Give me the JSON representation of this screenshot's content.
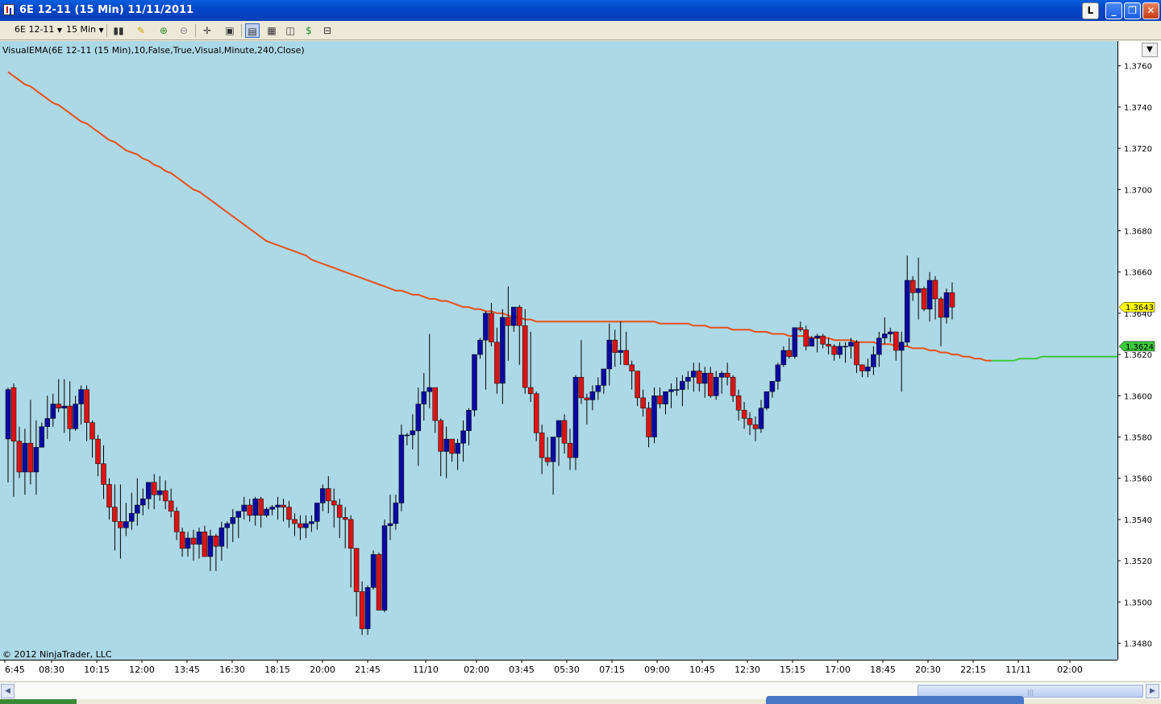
{
  "window": {
    "title": "6E 12-11 (15 Min)  11/11/2011",
    "link_button": "L",
    "min_button": "_",
    "max_button": "❐",
    "close_button": "✕"
  },
  "toolbar": {
    "instrument": "6E 12-11",
    "interval": "15 Min",
    "icons": [
      "bar-type-icon",
      "draw-tool-icon",
      "zoom-in-icon",
      "zoom-out-icon",
      "crosshair-icon",
      "properties-icon",
      "data-box-icon",
      "indicators-icon",
      "strategies-icon",
      "orders-icon",
      "tab-icon"
    ]
  },
  "indicator_label": "VisualEMA(6E 12-11 (15 Min),10,False,True,Visual,Minute,240,Close)",
  "copyright": "© 2012 NinjaTrader, LLC",
  "colors": {
    "background": "#add8e6",
    "up_candle": "#0a0aa0",
    "down_candle": "#dc1414",
    "ema_down": "#e8501a",
    "ema_up": "#3cc83c",
    "current_price_label": "#ffff00",
    "ema_price_label": "#3cc83c"
  },
  "chart_data": {
    "type": "candlestick",
    "title": "6E 12-11 (15 Min)",
    "ylim": [
      1.3472,
      1.3772
    ],
    "y_ticks": [
      "1.3760",
      "1.3740",
      "1.3720",
      "1.3700",
      "1.3680",
      "1.3660",
      "1.3640",
      "1.3620",
      "1.3600",
      "1.3580",
      "1.3560",
      "1.3540",
      "1.3520",
      "1.3500",
      "1.3480"
    ],
    "x_ticks": [
      "6:45",
      "08:30",
      "10:15",
      "12:00",
      "13:45",
      "16:30",
      "18:15",
      "20:00",
      "21:45",
      "11/10",
      "02:00",
      "03:45",
      "05:30",
      "07:15",
      "09:00",
      "10:45",
      "12:30",
      "15:15",
      "17:00",
      "18:45",
      "20:30",
      "22:15",
      "11/11",
      "02:00"
    ],
    "current_price": "1.3643",
    "ema_value": "1.3624",
    "candles_ohlc": [
      [
        1.3579,
        1.3604,
        1.3558,
        1.3603
      ],
      [
        1.3604,
        1.3606,
        1.3551,
        1.3578
      ],
      [
        1.3578,
        1.3585,
        1.356,
        1.3563
      ],
      [
        1.3563,
        1.3584,
        1.3552,
        1.3577
      ],
      [
        1.3577,
        1.3598,
        1.3557,
        1.3563
      ],
      [
        1.3563,
        1.3588,
        1.3552,
        1.3575
      ],
      [
        1.3575,
        1.3587,
        1.3576,
        1.3585
      ],
      [
        1.3585,
        1.36,
        1.3579,
        1.3589
      ],
      [
        1.3589,
        1.3601,
        1.3585,
        1.3596
      ],
      [
        1.3596,
        1.3608,
        1.3592,
        1.3594
      ],
      [
        1.3594,
        1.3608,
        1.3582,
        1.3595
      ],
      [
        1.3595,
        1.3607,
        1.3578,
        1.3584
      ],
      [
        1.3584,
        1.36,
        1.3583,
        1.3596
      ],
      [
        1.3596,
        1.3605,
        1.3586,
        1.3603
      ],
      [
        1.3603,
        1.3605,
        1.3578,
        1.3587
      ],
      [
        1.3587,
        1.3588,
        1.357,
        1.3579
      ],
      [
        1.3579,
        1.3581,
        1.3561,
        1.3567
      ],
      [
        1.3567,
        1.3576,
        1.355,
        1.3557
      ],
      [
        1.3557,
        1.356,
        1.354,
        1.3546
      ],
      [
        1.3546,
        1.3557,
        1.3525,
        1.3539
      ],
      [
        1.3539,
        1.3557,
        1.3521,
        1.3536
      ],
      [
        1.3536,
        1.3548,
        1.3532,
        1.3539
      ],
      [
        1.3539,
        1.3553,
        1.3535,
        1.3543
      ],
      [
        1.3543,
        1.356,
        1.3537,
        1.3547
      ],
      [
        1.3547,
        1.3555,
        1.3542,
        1.355
      ],
      [
        1.355,
        1.3558,
        1.3545,
        1.3558
      ],
      [
        1.3558,
        1.3562,
        1.3545,
        1.3552
      ],
      [
        1.3552,
        1.3561,
        1.3549,
        1.3554
      ],
      [
        1.3554,
        1.3559,
        1.3545,
        1.3549
      ],
      [
        1.3549,
        1.3555,
        1.3541,
        1.3544
      ],
      [
        1.3544,
        1.3546,
        1.353,
        1.3534
      ],
      [
        1.3534,
        1.3536,
        1.3522,
        1.3526
      ],
      [
        1.3526,
        1.3534,
        1.3522,
        1.3531
      ],
      [
        1.3531,
        1.3535,
        1.352,
        1.3528
      ],
      [
        1.3528,
        1.3536,
        1.3521,
        1.3534
      ],
      [
        1.3534,
        1.3537,
        1.3524,
        1.3522
      ],
      [
        1.3522,
        1.3535,
        1.3515,
        1.3532
      ],
      [
        1.3532,
        1.3533,
        1.3515,
        1.3527
      ],
      [
        1.3527,
        1.3539,
        1.352,
        1.3536
      ],
      [
        1.3536,
        1.3539,
        1.3526,
        1.3538
      ],
      [
        1.3538,
        1.3545,
        1.3529,
        1.3541
      ],
      [
        1.3541,
        1.3544,
        1.3531,
        1.3544
      ],
      [
        1.3544,
        1.3551,
        1.354,
        1.3547
      ],
      [
        1.3547,
        1.355,
        1.3539,
        1.3542
      ],
      [
        1.3542,
        1.3551,
        1.3537,
        1.355
      ],
      [
        1.355,
        1.3551,
        1.3536,
        1.3542
      ],
      [
        1.3542,
        1.3546,
        1.3541,
        1.3545
      ],
      [
        1.3545,
        1.3547,
        1.3542,
        1.3546
      ],
      [
        1.3546,
        1.3551,
        1.354,
        1.3547
      ],
      [
        1.3547,
        1.355,
        1.3539,
        1.3546
      ],
      [
        1.3546,
        1.3549,
        1.3536,
        1.354
      ],
      [
        1.354,
        1.3543,
        1.3532,
        1.3538
      ],
      [
        1.3538,
        1.3542,
        1.353,
        1.3536
      ],
      [
        1.3536,
        1.3542,
        1.3531,
        1.3538
      ],
      [
        1.3538,
        1.3542,
        1.3534,
        1.3539
      ],
      [
        1.3539,
        1.3547,
        1.3535,
        1.3548
      ],
      [
        1.3548,
        1.3557,
        1.3544,
        1.3555
      ],
      [
        1.3555,
        1.3561,
        1.3543,
        1.3549
      ],
      [
        1.3549,
        1.3555,
        1.3536,
        1.3547
      ],
      [
        1.3547,
        1.355,
        1.3531,
        1.3541
      ],
      [
        1.3541,
        1.3546,
        1.3526,
        1.354
      ],
      [
        1.354,
        1.3542,
        1.3507,
        1.3526
      ],
      [
        1.3526,
        1.3526,
        1.3493,
        1.3505
      ],
      [
        1.3505,
        1.351,
        1.3484,
        1.3487
      ],
      [
        1.3487,
        1.3508,
        1.3484,
        1.3507
      ],
      [
        1.3507,
        1.3525,
        1.3506,
        1.3523
      ],
      [
        1.3523,
        1.3524,
        1.3496,
        1.3496
      ],
      [
        1.3496,
        1.354,
        1.3495,
        1.3537
      ],
      [
        1.3537,
        1.3552,
        1.353,
        1.3538
      ],
      [
        1.3538,
        1.3552,
        1.3535,
        1.3548
      ],
      [
        1.3548,
        1.3586,
        1.3544,
        1.3581
      ],
      [
        1.3581,
        1.3582,
        1.3576,
        1.3581
      ],
      [
        1.3581,
        1.3591,
        1.3574,
        1.3583
      ],
      [
        1.3583,
        1.3604,
        1.3566,
        1.3596
      ],
      [
        1.3596,
        1.3611,
        1.3588,
        1.3602
      ],
      [
        1.3602,
        1.363,
        1.3594,
        1.3604
      ],
      [
        1.3604,
        1.3603,
        1.3582,
        1.3588
      ],
      [
        1.3588,
        1.3589,
        1.3561,
        1.3573
      ],
      [
        1.3573,
        1.3585,
        1.356,
        1.3579
      ],
      [
        1.3579,
        1.3579,
        1.3568,
        1.3572
      ],
      [
        1.3572,
        1.3579,
        1.3564,
        1.3577
      ],
      [
        1.3577,
        1.3588,
        1.3568,
        1.3583
      ],
      [
        1.3583,
        1.3594,
        1.3576,
        1.3593
      ],
      [
        1.3593,
        1.3614,
        1.359,
        1.362
      ],
      [
        1.362,
        1.3628,
        1.3618,
        1.3627
      ],
      [
        1.3627,
        1.3641,
        1.3603,
        1.364
      ],
      [
        1.364,
        1.3645,
        1.3624,
        1.3626
      ],
      [
        1.3626,
        1.3633,
        1.3601,
        1.3606
      ],
      [
        1.3606,
        1.3642,
        1.3596,
        1.3638
      ],
      [
        1.3638,
        1.3653,
        1.3617,
        1.3634
      ],
      [
        1.3634,
        1.3643,
        1.3631,
        1.3643
      ],
      [
        1.3643,
        1.3644,
        1.3615,
        1.3634
      ],
      [
        1.3634,
        1.3642,
        1.3601,
        1.3604
      ],
      [
        1.3604,
        1.3631,
        1.3597,
        1.3601
      ],
      [
        1.3601,
        1.3602,
        1.3578,
        1.3582
      ],
      [
        1.3582,
        1.3586,
        1.3562,
        1.357
      ],
      [
        1.357,
        1.358,
        1.3566,
        1.3568
      ],
      [
        1.3568,
        1.3578,
        1.3552,
        1.358
      ],
      [
        1.358,
        1.3588,
        1.3566,
        1.3588
      ],
      [
        1.3588,
        1.3591,
        1.3572,
        1.3577
      ],
      [
        1.3577,
        1.3584,
        1.3564,
        1.357
      ],
      [
        1.357,
        1.361,
        1.3564,
        1.3609
      ],
      [
        1.3609,
        1.3627,
        1.3596,
        1.3599
      ],
      [
        1.3599,
        1.3601,
        1.3586,
        1.3598
      ],
      [
        1.3598,
        1.3605,
        1.3593,
        1.3602
      ],
      [
        1.3602,
        1.3609,
        1.3598,
        1.3605
      ],
      [
        1.3605,
        1.3613,
        1.3601,
        1.3613
      ],
      [
        1.3613,
        1.3635,
        1.3605,
        1.3627
      ],
      [
        1.3627,
        1.3632,
        1.3614,
        1.3621
      ],
      [
        1.3621,
        1.3636,
        1.3615,
        1.3622
      ],
      [
        1.3622,
        1.3631,
        1.3615,
        1.3615
      ],
      [
        1.3615,
        1.3617,
        1.3603,
        1.3612
      ],
      [
        1.3612,
        1.3612,
        1.3595,
        1.3599
      ],
      [
        1.3599,
        1.3603,
        1.359,
        1.3594
      ],
      [
        1.3594,
        1.3597,
        1.3575,
        1.358
      ],
      [
        1.358,
        1.3604,
        1.3577,
        1.36
      ],
      [
        1.36,
        1.3604,
        1.3594,
        1.3596
      ],
      [
        1.3596,
        1.3601,
        1.3591,
        1.3602
      ],
      [
        1.3602,
        1.3606,
        1.3594,
        1.3603
      ],
      [
        1.3603,
        1.3609,
        1.36,
        1.3603
      ],
      [
        1.3603,
        1.361,
        1.3595,
        1.3607
      ],
      [
        1.3607,
        1.3612,
        1.3603,
        1.3609
      ],
      [
        1.3609,
        1.3616,
        1.3602,
        1.3612
      ],
      [
        1.3612,
        1.3616,
        1.3602,
        1.3606
      ],
      [
        1.3606,
        1.3614,
        1.3599,
        1.3611
      ],
      [
        1.3611,
        1.3614,
        1.3599,
        1.36
      ],
      [
        1.36,
        1.3612,
        1.3598,
        1.3609
      ],
      [
        1.3609,
        1.3612,
        1.3601,
        1.3611
      ],
      [
        1.3611,
        1.3616,
        1.3605,
        1.3609
      ],
      [
        1.3609,
        1.361,
        1.3597,
        1.36
      ],
      [
        1.36,
        1.3603,
        1.3588,
        1.3593
      ],
      [
        1.3593,
        1.3597,
        1.3584,
        1.3589
      ],
      [
        1.3589,
        1.3592,
        1.3581,
        1.3586
      ],
      [
        1.3586,
        1.359,
        1.3578,
        1.3584
      ],
      [
        1.3584,
        1.3598,
        1.3582,
        1.3594
      ],
      [
        1.3594,
        1.3601,
        1.3593,
        1.3602
      ],
      [
        1.3602,
        1.3607,
        1.3599,
        1.3607
      ],
      [
        1.3607,
        1.3616,
        1.3603,
        1.3615
      ],
      [
        1.3615,
        1.3624,
        1.3614,
        1.3622
      ],
      [
        1.3622,
        1.3628,
        1.3618,
        1.3619
      ],
      [
        1.3619,
        1.3633,
        1.3618,
        1.3633
      ],
      [
        1.3633,
        1.3636,
        1.3631,
        1.3632
      ],
      [
        1.3632,
        1.3634,
        1.3622,
        1.3624
      ],
      [
        1.3624,
        1.3629,
        1.3624,
        1.3628
      ],
      [
        1.3628,
        1.363,
        1.3621,
        1.3629
      ],
      [
        1.3629,
        1.363,
        1.3623,
        1.3625
      ],
      [
        1.3625,
        1.3628,
        1.362,
        1.3624
      ],
      [
        1.3624,
        1.3625,
        1.3617,
        1.362
      ],
      [
        1.362,
        1.3626,
        1.3618,
        1.3624
      ],
      [
        1.3624,
        1.3626,
        1.3616,
        1.3624
      ],
      [
        1.3624,
        1.3628,
        1.3618,
        1.3626
      ],
      [
        1.3626,
        1.3627,
        1.3611,
        1.3615
      ],
      [
        1.3615,
        1.3615,
        1.3609,
        1.3612
      ],
      [
        1.3612,
        1.3618,
        1.3609,
        1.3614
      ],
      [
        1.3614,
        1.3624,
        1.361,
        1.362
      ],
      [
        1.362,
        1.3631,
        1.3614,
        1.3628
      ],
      [
        1.3628,
        1.3638,
        1.3625,
        1.363
      ],
      [
        1.363,
        1.3633,
        1.3626,
        1.3631
      ],
      [
        1.3631,
        1.363,
        1.3617,
        1.3622
      ],
      [
        1.3622,
        1.3631,
        1.3602,
        1.3626
      ],
      [
        1.3626,
        1.3668,
        1.3624,
        1.3656
      ],
      [
        1.3656,
        1.3658,
        1.3646,
        1.365
      ],
      [
        1.365,
        1.3667,
        1.3637,
        1.3652
      ],
      [
        1.3652,
        1.3653,
        1.3641,
        1.3642
      ],
      [
        1.3642,
        1.366,
        1.3636,
        1.3656
      ],
      [
        1.3656,
        1.3658,
        1.3637,
        1.3647
      ],
      [
        1.3647,
        1.3648,
        1.3624,
        1.3638
      ],
      [
        1.3638,
        1.3652,
        1.3635,
        1.365
      ],
      [
        1.365,
        1.3655,
        1.3637,
        1.3643
      ]
    ],
    "ema": [
      1.3757,
      1.3755,
      1.3753,
      1.3751,
      1.375,
      1.3748,
      1.3746,
      1.3744,
      1.3742,
      1.3741,
      1.3739,
      1.3737,
      1.3735,
      1.3733,
      1.3732,
      1.373,
      1.3728,
      1.3726,
      1.3724,
      1.3723,
      1.3721,
      1.3719,
      1.3718,
      1.3717,
      1.3715,
      1.3714,
      1.3712,
      1.3711,
      1.3709,
      1.3708,
      1.3706,
      1.3704,
      1.3702,
      1.37,
      1.3699,
      1.3697,
      1.3695,
      1.3693,
      1.3691,
      1.3689,
      1.3687,
      1.3685,
      1.3683,
      1.3681,
      1.3679,
      1.3677,
      1.3675,
      1.3674,
      1.3673,
      1.3672,
      1.3671,
      1.367,
      1.3669,
      1.3668,
      1.3666,
      1.3665,
      1.3664,
      1.3663,
      1.3662,
      1.3661,
      1.366,
      1.3659,
      1.3658,
      1.3657,
      1.3656,
      1.3655,
      1.3654,
      1.3653,
      1.3652,
      1.3651,
      1.3651,
      1.365,
      1.3649,
      1.3649,
      1.3648,
      1.3647,
      1.3647,
      1.3646,
      1.3646,
      1.3645,
      1.3644,
      1.3643,
      1.3643,
      1.3642,
      1.3642,
      1.3641,
      1.3641,
      1.364,
      1.364,
      1.3639,
      1.3638,
      1.3638,
      1.3637,
      1.3637,
      1.3636,
      1.3636,
      1.3636,
      1.3636,
      1.3636,
      1.3636,
      1.3636,
      1.3636,
      1.3636,
      1.3636,
      1.3636,
      1.3636,
      1.3636,
      1.3636,
      1.3636,
      1.3636,
      1.3636,
      1.3636,
      1.3636,
      1.3636,
      1.3636,
      1.3636,
      1.3635,
      1.3635,
      1.3635,
      1.3635,
      1.3635,
      1.3635,
      1.3634,
      1.3634,
      1.3634,
      1.3633,
      1.3633,
      1.3633,
      1.3633,
      1.3632,
      1.3632,
      1.3632,
      1.3632,
      1.3631,
      1.3631,
      1.3631,
      1.363,
      1.363,
      1.363,
      1.3629,
      1.3629,
      1.3629,
      1.3629,
      1.3628,
      1.3628,
      1.3628,
      1.3628,
      1.3627,
      1.3627,
      1.3627,
      1.3627,
      1.3626,
      1.3626,
      1.3626,
      1.3626,
      1.3625,
      1.3625,
      1.3625,
      1.3624,
      1.3624,
      1.3624,
      1.3623,
      1.3623,
      1.3623,
      1.3622,
      1.3622,
      1.3621,
      1.3621,
      1.362,
      1.362,
      1.3619,
      1.3619,
      1.3618,
      1.3618,
      1.3617,
      1.3617
    ],
    "ema_tail": [
      1.3617,
      1.3617,
      1.3617,
      1.3617,
      1.3618,
      1.3618,
      1.3618,
      1.3618,
      1.3619,
      1.3619,
      1.3619,
      1.3619,
      1.3619,
      1.3619,
      1.3619,
      1.3619,
      1.3619,
      1.3619,
      1.3619,
      1.3619,
      1.3619,
      1.3619,
      1.3619,
      1.3619,
      1.362,
      1.362,
      1.362,
      1.3621,
      1.3621,
      1.3621,
      1.3621,
      1.3622,
      1.3622,
      1.3622,
      1.3622,
      1.3623,
      1.3623,
      1.3623,
      1.3623,
      1.3624,
      1.3624,
      1.3624,
      1.3624,
      1.3625,
      1.3625,
      1.3625,
      1.3625,
      1.3624,
      1.3624
    ]
  }
}
